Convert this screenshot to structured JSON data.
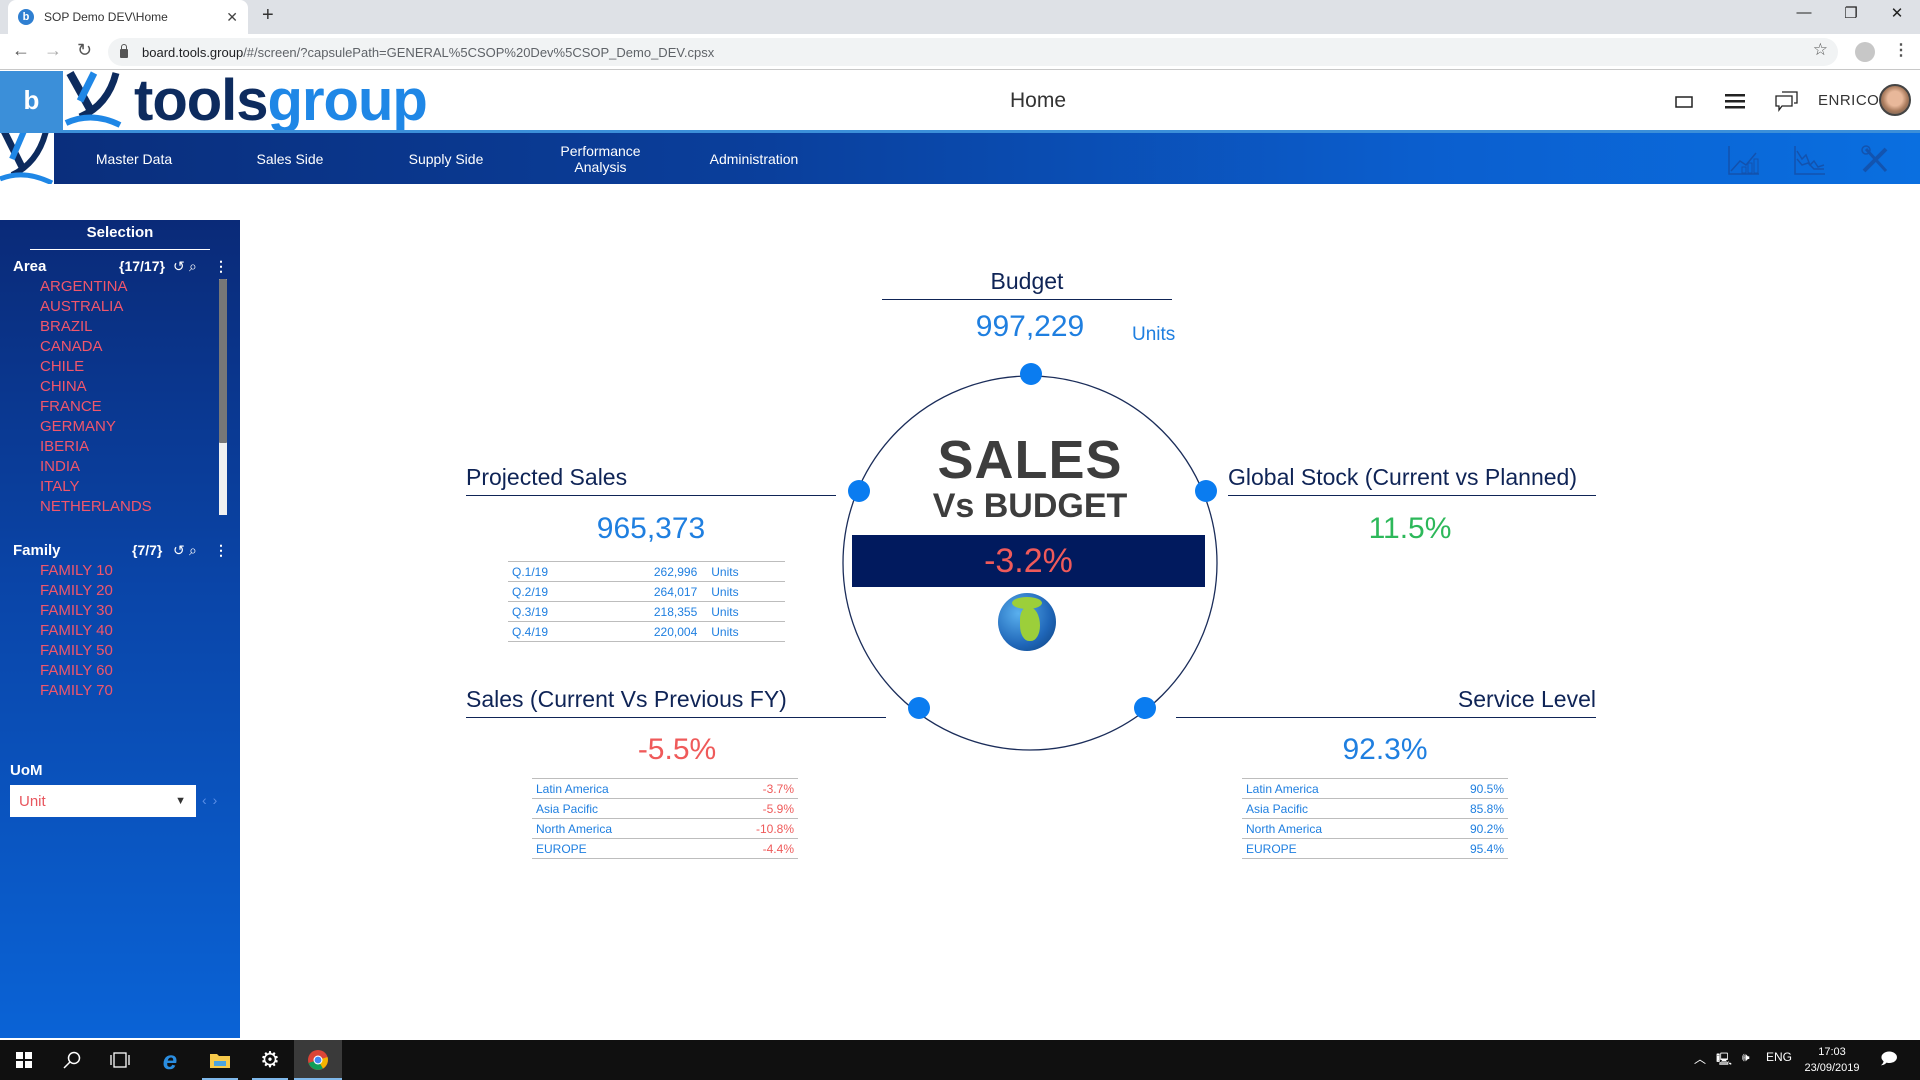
{
  "browser": {
    "tab_title": "SOP Demo DEV\\Home",
    "url_host": "board.tools.group",
    "url_path": "/#/screen/?capsulePath=GENERAL%5CSOP%20Dev%5CSOP_Demo_DEV.cpsx"
  },
  "header": {
    "logo_part1": "tools",
    "logo_part2": "group",
    "board_label": "b",
    "page_title": "Home",
    "user_name": "ENRICO"
  },
  "nav": {
    "items": [
      {
        "label": "Master Data"
      },
      {
        "label": "Sales Side"
      },
      {
        "label": "Supply Side"
      },
      {
        "label": "Performance Analysis"
      },
      {
        "label": "Administration"
      }
    ]
  },
  "sidebar": {
    "title": "Selection",
    "area": {
      "label": "Area",
      "count": "{17/17}",
      "items": [
        "ARGENTINA",
        "AUSTRALIA",
        "BRAZIL",
        "CANADA",
        "CHILE",
        "CHINA",
        "FRANCE",
        "GERMANY",
        "IBERIA",
        "INDIA",
        "ITALY",
        "NETHERLANDS"
      ]
    },
    "family": {
      "label": "Family",
      "count": "{7/7}",
      "items": [
        "FAMILY 10",
        "FAMILY 20",
        "FAMILY 30",
        "FAMILY 40",
        "FAMILY 50",
        "FAMILY 60",
        "FAMILY 70"
      ]
    },
    "uom": {
      "label": "UoM",
      "value": "Unit"
    }
  },
  "dashboard": {
    "center": {
      "line1": "SALES",
      "line2": "Vs BUDGET",
      "value": "-3.2%"
    },
    "budget": {
      "title": "Budget",
      "value": "997,229",
      "unit": "Units"
    },
    "projected_sales": {
      "title": "Projected Sales",
      "value": "965,373",
      "rows": [
        {
          "label": "Q.1/19",
          "value": "262,996",
          "unit": "Units"
        },
        {
          "label": "Q.2/19",
          "value": "264,017",
          "unit": "Units"
        },
        {
          "label": "Q.3/19",
          "value": "218,355",
          "unit": "Units"
        },
        {
          "label": "Q.4/19",
          "value": "220,004",
          "unit": "Units"
        }
      ]
    },
    "global_stock": {
      "title": "Global Stock (Current vs Planned)",
      "value": "11.5%"
    },
    "sales_vs_prev": {
      "title": "Sales (Current Vs Previous FY)",
      "value": "-5.5%",
      "rows": [
        {
          "label": "Latin America",
          "value": "-3.7%"
        },
        {
          "label": "Asia Pacific",
          "value": "-5.9%"
        },
        {
          "label": "North America",
          "value": "-10.8%"
        },
        {
          "label": "EUROPE",
          "value": "-4.4%"
        }
      ]
    },
    "service_level": {
      "title": "Service Level",
      "value": "92.3%",
      "rows": [
        {
          "label": "Latin America",
          "value": "90.5%"
        },
        {
          "label": "Asia Pacific",
          "value": "85.8%"
        },
        {
          "label": "North America",
          "value": "90.2%"
        },
        {
          "label": "EUROPE",
          "value": "95.4%"
        }
      ]
    }
  },
  "taskbar": {
    "lang": "ENG",
    "time": "17:03",
    "date": "23/09/2019"
  },
  "colors": {
    "accent_blue": "#1f7fe0",
    "negative_red": "#ef5a5a",
    "positive_green": "#2db85a",
    "navy": "#011a5e"
  }
}
